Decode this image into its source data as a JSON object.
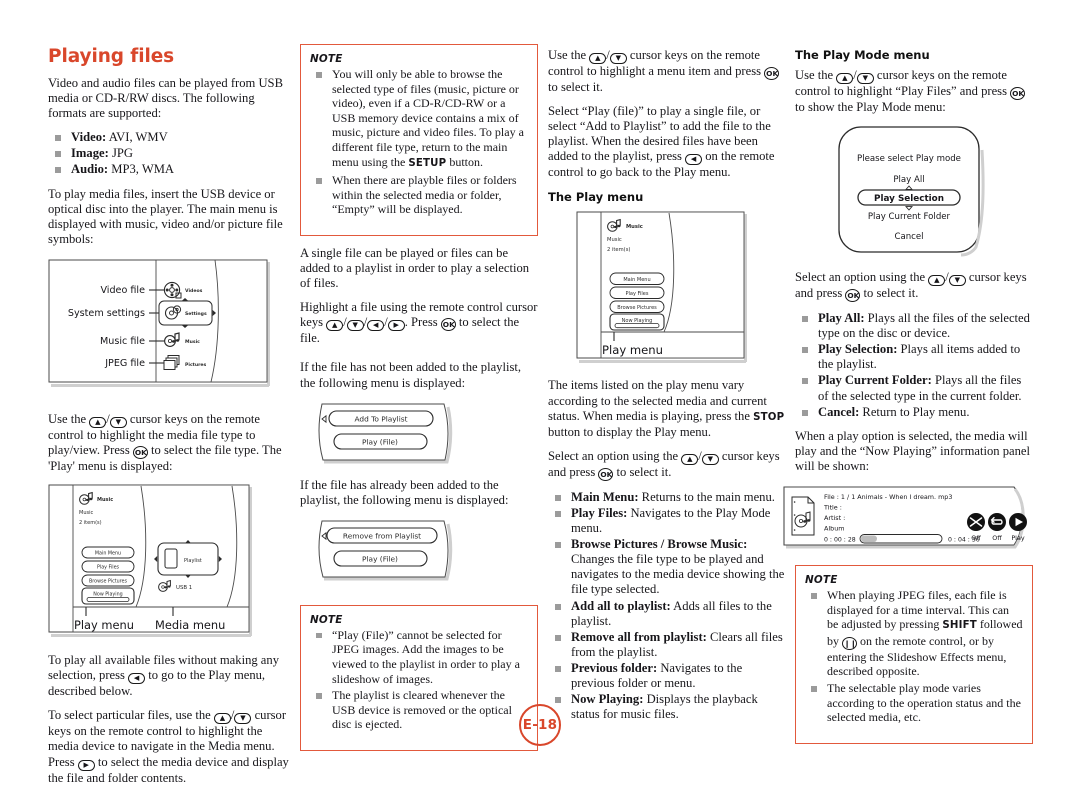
{
  "page": {
    "number_badge": "E-18",
    "title": "Playing files"
  },
  "col1": {
    "intro": "Video and audio files can be played from USB media or CD-R/RW discs. The following formats are supported:",
    "formats": [
      {
        "label": "Video:",
        "value": "AVI, WMV"
      },
      {
        "label": "Image:",
        "value": "JPG"
      },
      {
        "label": "Audio:",
        "value": "MP3, WMA"
      }
    ],
    "para2": "To play media files, insert the USB device or optical disc into the player. The main menu is displayed with music, video and/or picture file symbols:",
    "figure_main_menu": {
      "callouts": [
        "Video file",
        "System settings",
        "Music file",
        "JPEG file"
      ],
      "items": [
        "Videos",
        "Settings",
        "Music",
        "Pictures"
      ]
    },
    "para3_a": "Use the ",
    "para3_b": " cursor keys on the remote control to highlight the media file type to play/view. Press ",
    "para3_c": " to select the file type. The 'Play' menu is displayed:",
    "figure_play_media": {
      "header_icon_label": "Music",
      "line1": "Music",
      "line2": "2 item(s)",
      "buttons": [
        "Main Menu",
        "Play Files",
        "Browse Pictures",
        "Now Playing"
      ],
      "media_item": "Playlist",
      "device_item": "USB 1",
      "caption_left": "Play menu",
      "caption_right": "Media menu"
    },
    "para4_a": "To play all available files without making any selection, press ",
    "para4_b": " to go to the Play menu, described below.",
    "para5_a": "To select particular files, use the ",
    "para5_b": " cursor keys on the remote control to highlight the media device to navigate in the Media menu. Press ",
    "para5_c": " to select the media device and display the file and folder contents."
  },
  "col2": {
    "note1_label": "NOTE",
    "note1_items": [
      "You will only be able to browse the selected type of files (music, picture or video), even if a CD-R/CD-RW or a USB memory device contains a mix of music, picture and video files. To play a different file type, return to the main menu using the SETUP button.",
      "When there are playble files or folders within the selected media or folder, “Empty” will be displayed."
    ],
    "note1_item1_pre": "You will only be able to browse the selected type of files (music, picture or video), even if a CD-R/CD-RW or a USB memory device contains a mix of music, picture and video files. To play a different file type, return to the main menu using the ",
    "note1_item1_sc": "SETUP",
    "note1_item1_post": " button.",
    "para1": "A single file can be played or files can be added to a playlist in order to play a selection of files.",
    "para2_a": "Highlight a file using the remote control cursor keys ",
    "para2_b": ". Press ",
    "para2_c": " to select the file.",
    "para3": "If the file has not been added to the playlist, the following menu is displayed:",
    "figure_add": {
      "buttons": [
        "Add To Playlist",
        "Play (File)"
      ]
    },
    "para4": "If the file has already been added to the playlist, the following menu is displayed:",
    "figure_remove": {
      "buttons": [
        "Remove from Playlist",
        "Play (File)"
      ]
    },
    "note2_label": "NOTE",
    "note2_items": [
      "“Play (File)” cannot be selected for JPEG images. Add the images to be viewed to the playlist in order to play a slideshow of images.",
      "The playlist is cleared whenever the USB device is removed or the optical disc is ejected."
    ]
  },
  "col3": {
    "para1_a": "Use the ",
    "para1_b": " cursor keys on the remote control to highlight a menu item and press ",
    "para1_c": " to select it.",
    "para2_a": "Select “Play (file)” to play a single file, or select “Add to Playlist” to add the file to the playlist. When the desired files have been added to the playlist, press ",
    "para2_b": " on the remote control to go back to the Play menu.",
    "heading": "The Play menu",
    "figure_play_menu": {
      "header_icon_label": "Music",
      "line1": "Music",
      "line2": "2 item(s)",
      "buttons": [
        "Main Menu",
        "Play Files",
        "Browse Pictures",
        "Now Playing"
      ],
      "caption": "Play menu"
    },
    "para3_a": "The items listed on the play menu vary according to the selected media and current status. When media is playing, press the ",
    "para3_sc": "STOP",
    "para3_b": " button to display the Play menu.",
    "para4_a": "Select an option using the ",
    "para4_b": " cursor keys and press ",
    "para4_c": " to select it.",
    "items": [
      {
        "label": "Main Menu:",
        "text": " Returns to the main menu."
      },
      {
        "label": "Play Files:",
        "text": " Navigates to the Play Mode menu."
      },
      {
        "label": "Browse Pictures / Browse Music:",
        "text": " Changes the file type to be played and navigates to the media device showing the file type selected."
      },
      {
        "label": "Add all to playlist:",
        "text": " Adds all files to the playlist."
      },
      {
        "label": "Remove all from playlist:",
        "text": " Clears all files from the playlist."
      },
      {
        "label": "Previous folder:",
        "text": " Navigates to the previous folder or menu."
      },
      {
        "label": "Now Playing:",
        "text": " Displays the playback status for music files."
      }
    ]
  },
  "col4": {
    "heading": "The Play Mode menu",
    "para1_a": "Use the ",
    "para1_b": " cursor keys on the remote control to highlight “Play Files” and press ",
    "para1_c": " to show the Play Mode menu:",
    "figure_play_mode": {
      "prompt": "Please select Play mode",
      "options": [
        "Play All",
        "Play Selection",
        "Play Current Folder",
        "Cancel"
      ],
      "selected": "Play Selection"
    },
    "para2_a": "Select an option using the ",
    "para2_b": " cursor keys and press ",
    "para2_c": " to select it.",
    "items": [
      {
        "label": "Play All:",
        "text": " Plays all the files of the selected type on the disc or device."
      },
      {
        "label": "Play Selection:",
        "text": " Plays all items added to the playlist."
      },
      {
        "label": "Play Current Folder:",
        "text": " Plays all the files of the selected type in the current folder."
      },
      {
        "label": "Cancel:",
        "text": " Return to Play menu."
      }
    ],
    "para3": "When a play option is selected, the media will play and the “Now Playing” information panel will be shown:",
    "figure_now_playing": {
      "file_line": "File : 1 / 1 Animals - When I dream. mp3",
      "title_line": "Title :",
      "artist_line": "Artist :",
      "album_line": "Album",
      "elapsed": "0 : 00 : 28",
      "total": "0 : 04 : 36",
      "shuffle_label": "Off",
      "repeat_label": "Off",
      "play_label": "Play"
    },
    "note_label": "NOTE",
    "note_item1_pre": "When playing JPEG files, each file is displayed for a time interval. This can be adjusted by pressing ",
    "note_item1_sc": "SHIFT",
    "note_item1_mid": " followed by ",
    "note_item1_post": " on the remote control, or by entering the Slideshow Effects menu, described opposite.",
    "note_item2": "The selectable play mode varies according to the operation status and the selected media, etc."
  },
  "colors": {
    "heading": "#d9472b",
    "note_border": "#e2593c",
    "bullet": "#9b9b9b"
  }
}
